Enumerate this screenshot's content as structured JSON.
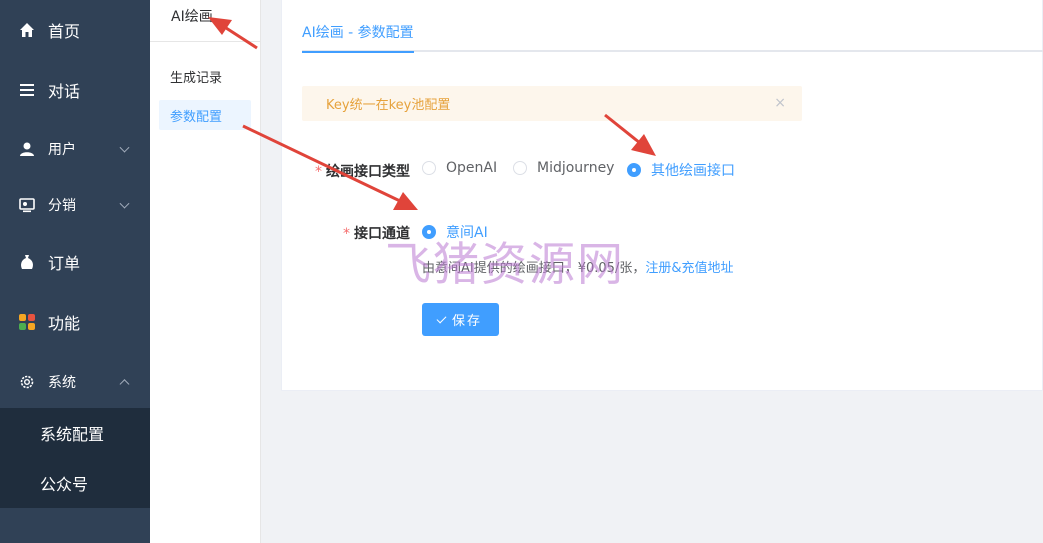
{
  "sidebar": {
    "items": [
      {
        "label": "首页",
        "icon": "home-icon"
      },
      {
        "label": "对话",
        "icon": "menu-lines-icon"
      },
      {
        "label": "用户",
        "icon": "user-icon"
      },
      {
        "label": "分销",
        "icon": "distribution-icon"
      },
      {
        "label": "订单",
        "icon": "order-bag-icon"
      },
      {
        "label": "功能",
        "icon": "grid-icon"
      },
      {
        "label": "系统",
        "icon": "gear-icon"
      }
    ],
    "submenu": [
      "系统配置",
      "公众号"
    ]
  },
  "subnav": {
    "title": "AI绘画",
    "items": [
      "生成记录",
      "参数配置"
    ],
    "active_index": 1
  },
  "main": {
    "tab": "AI绘画 - 参数配置",
    "alert": "Key统一在key池配置",
    "alert_close": "×",
    "form": {
      "type_label": "绘画接口类型",
      "type_options": [
        "OpenAI",
        "Midjourney",
        "其他绘画接口"
      ],
      "type_selected": "其他绘画接口",
      "channel_label": "接口通道",
      "channel_options": [
        "意间AI"
      ],
      "channel_selected": "意间AI",
      "hint_text": "由意间AI提供的绘画接口，¥0.05/张，",
      "hint_link": "注册&充值地址",
      "save_label": "保存"
    }
  },
  "watermark": "飞猪资源网",
  "colors": {
    "sidebar_bg": "#304156",
    "submenu_bg": "#1f2d3d",
    "primary": "#409eff",
    "warning": "#e6a23c",
    "annotation_arrow": "#e0443a"
  }
}
